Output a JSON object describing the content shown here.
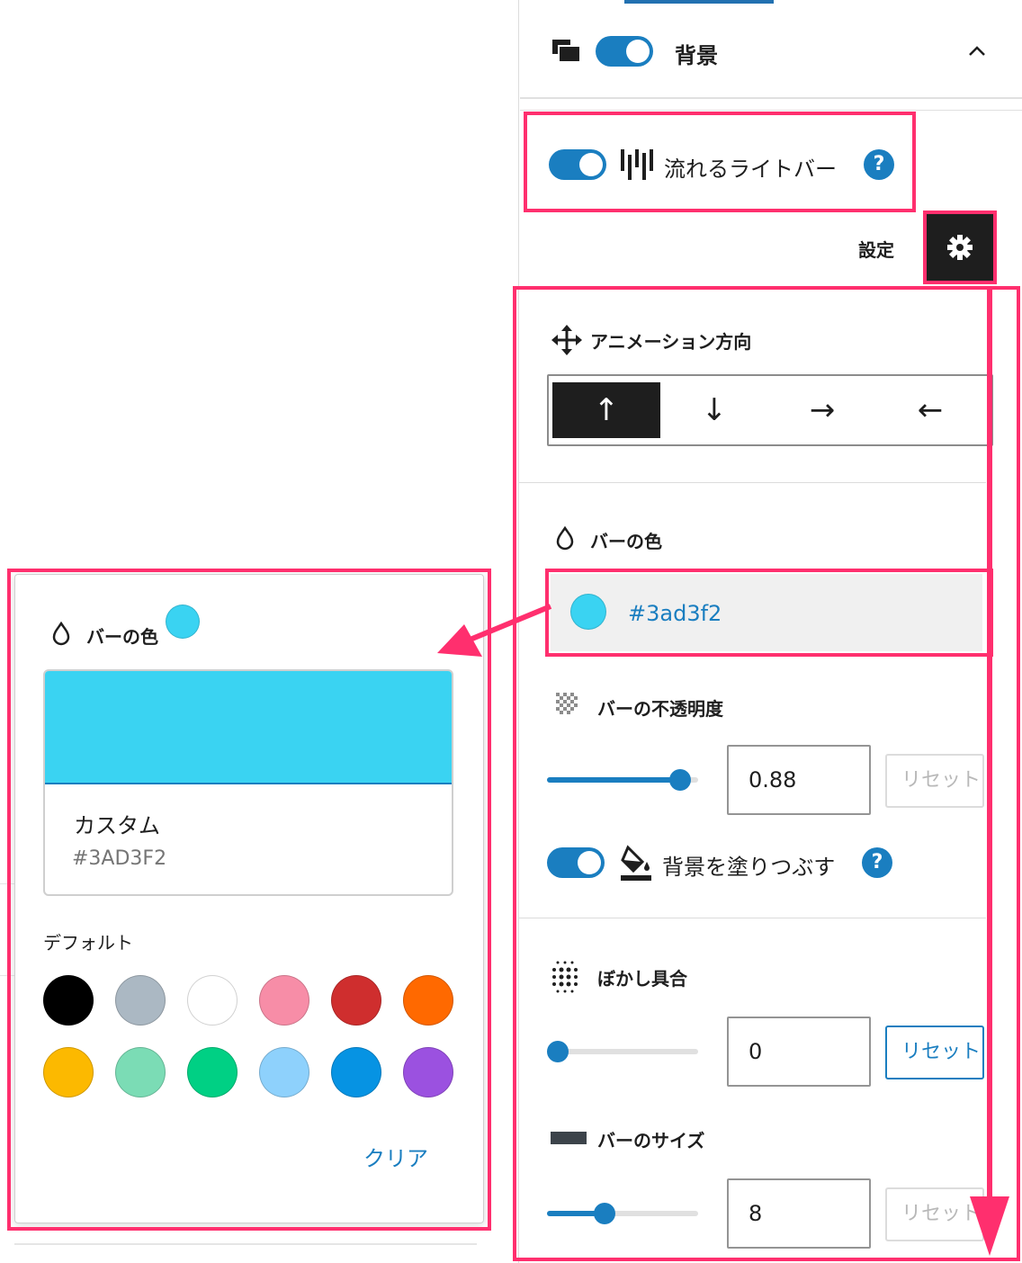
{
  "background_section": {
    "title": "背景",
    "collapse_icon": "chevron-up-icon",
    "layers_icon": "layers-icon"
  },
  "light_bar": {
    "label": "流れるライトバー",
    "icon": "light-bars-icon",
    "help": "?",
    "enabled": true
  },
  "settings": {
    "label": "設定",
    "icon": "gear-icon"
  },
  "animation_direction": {
    "label": "アニメーション方向",
    "icon": "move-arrows-icon",
    "options": [
      "↑",
      "↓",
      "→",
      "←"
    ],
    "selected_index": 0
  },
  "bar_color": {
    "label": "バーの色",
    "icon": "droplet-icon",
    "value": "#3ad3f2"
  },
  "bar_opacity": {
    "label": "バーの不透明度",
    "icon": "checker-icon",
    "value": "0.88",
    "slider_fraction": 0.88,
    "reset": "リセット"
  },
  "fill_background": {
    "label": "背景を塗りつぶす",
    "icon": "paint-bucket-icon",
    "help": "?",
    "enabled": true
  },
  "blur": {
    "label": "ぼかし具合",
    "icon": "blur-dots-icon",
    "value": "0",
    "slider_fraction": 0,
    "reset": "リセット"
  },
  "bar_size": {
    "label": "バーのサイズ",
    "icon": "bar-rect-icon",
    "value": "8",
    "slider_fraction": 0.38,
    "reset": "リセット"
  },
  "color_popover": {
    "label": "バーの色",
    "icon": "droplet-icon",
    "custom_label": "カスタム",
    "custom_hex": "#3AD3F2",
    "default_label": "デフォルト",
    "palette": [
      "#000000",
      "#abb8c3",
      "#ffffff",
      "#f78da7",
      "#cf2e2e",
      "#ff6900",
      "#fcb900",
      "#7bdcb5",
      "#00d084",
      "#8ed1fc",
      "#0693e3",
      "#9b51e0"
    ],
    "clear": "クリア"
  },
  "colors": {
    "accent": "#1a7ec0",
    "highlight": "#ff2f6e",
    "selected_color": "#3ad3f2"
  }
}
